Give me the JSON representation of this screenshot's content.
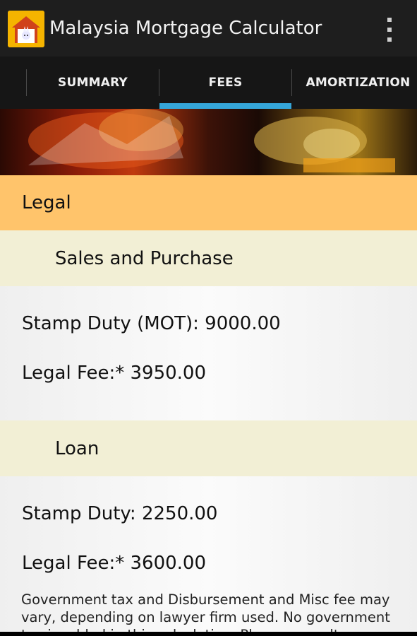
{
  "app": {
    "title": "Malaysia Mortgage Calculator",
    "icon": "house-app-icon",
    "menu_icon": "overflow-menu-icon"
  },
  "tabs": [
    {
      "label": "SUMMARY",
      "selected": false
    },
    {
      "label": "FEES",
      "selected": true
    },
    {
      "label": "AMORTIZATION",
      "selected": false
    }
  ],
  "colors": {
    "accent": "#35a6d9",
    "section_header": "#ffc46b",
    "subsection_header": "#f2efd5"
  },
  "fees": {
    "legal_header": "Legal",
    "sales": {
      "title": "Sales and Purchase",
      "stamp_duty": "Stamp Duty (MOT): 9000.00",
      "legal_fee": "Legal Fee:* 3950.00"
    },
    "loan": {
      "title": "Loan",
      "stamp_duty": "Stamp Duty: 2250.00",
      "legal_fee": "Legal Fee:* 3600.00"
    },
    "note": "Government tax and Disbursement and Misc fee may vary, depending on lawyer firm used. No government tax is added in this calculation. Please consult your"
  }
}
